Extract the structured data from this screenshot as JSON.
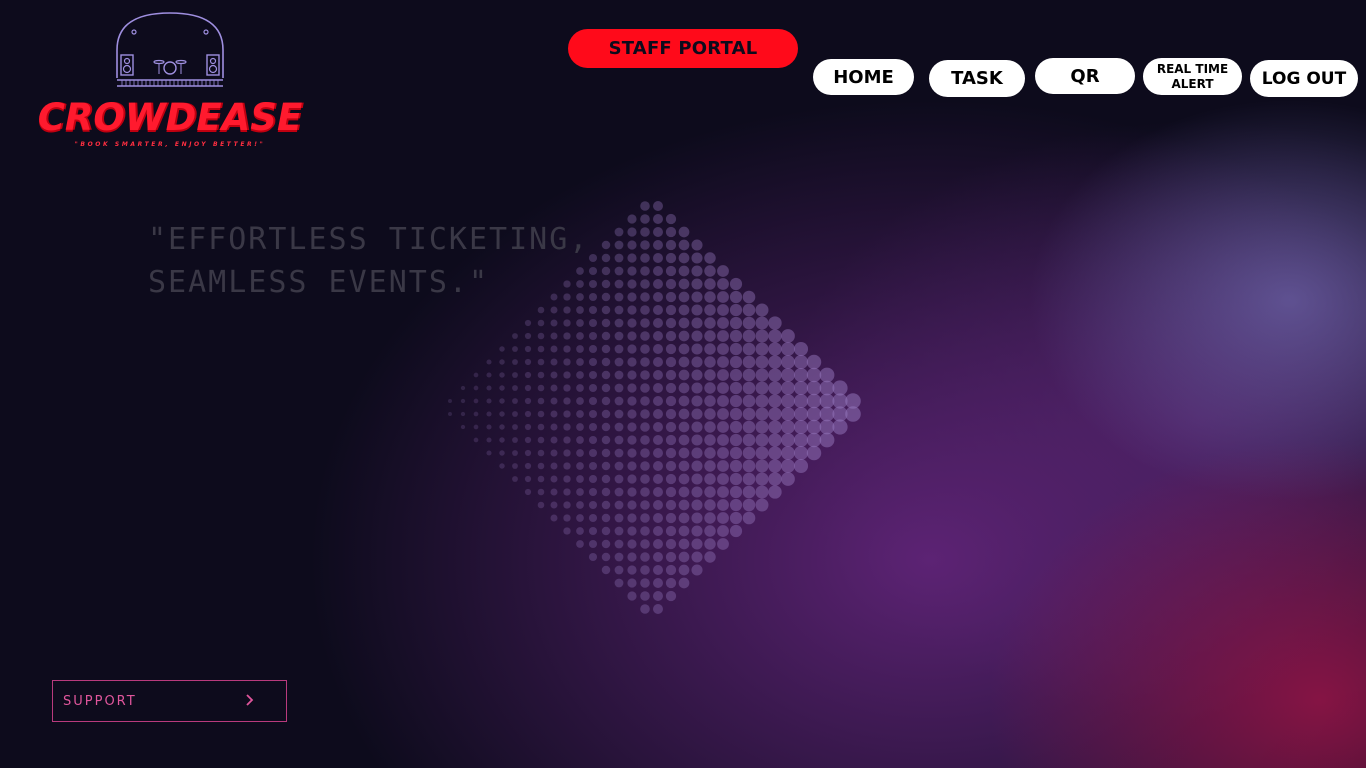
{
  "brand": {
    "name": "CROWDEASE",
    "tagline": "\"BOOK SMARTER, ENJOY BETTER!\""
  },
  "header": {
    "staff_portal_label": "STAFF PORTAL"
  },
  "nav": {
    "home": "HOME",
    "task": "TASK",
    "qr": "QR",
    "alert_line1": "REAL TIME",
    "alert_line2": "ALERT",
    "logout": "LOG OUT"
  },
  "hero": {
    "line1": "\"EFFORTLESS TICKETING,",
    "line2": "SEAMLESS EVENTS.\""
  },
  "support": {
    "label": "SUPPORT"
  },
  "colors": {
    "background": "#0d0b1c",
    "brand_red": "#ff0a1a",
    "nav_pill": "#ffffff",
    "support_accent": "#e0569c",
    "logo_line": "#9f8fe0"
  },
  "icons": {
    "logo": "stage-dome-icon",
    "support_arrow": "chevron-right-icon"
  }
}
